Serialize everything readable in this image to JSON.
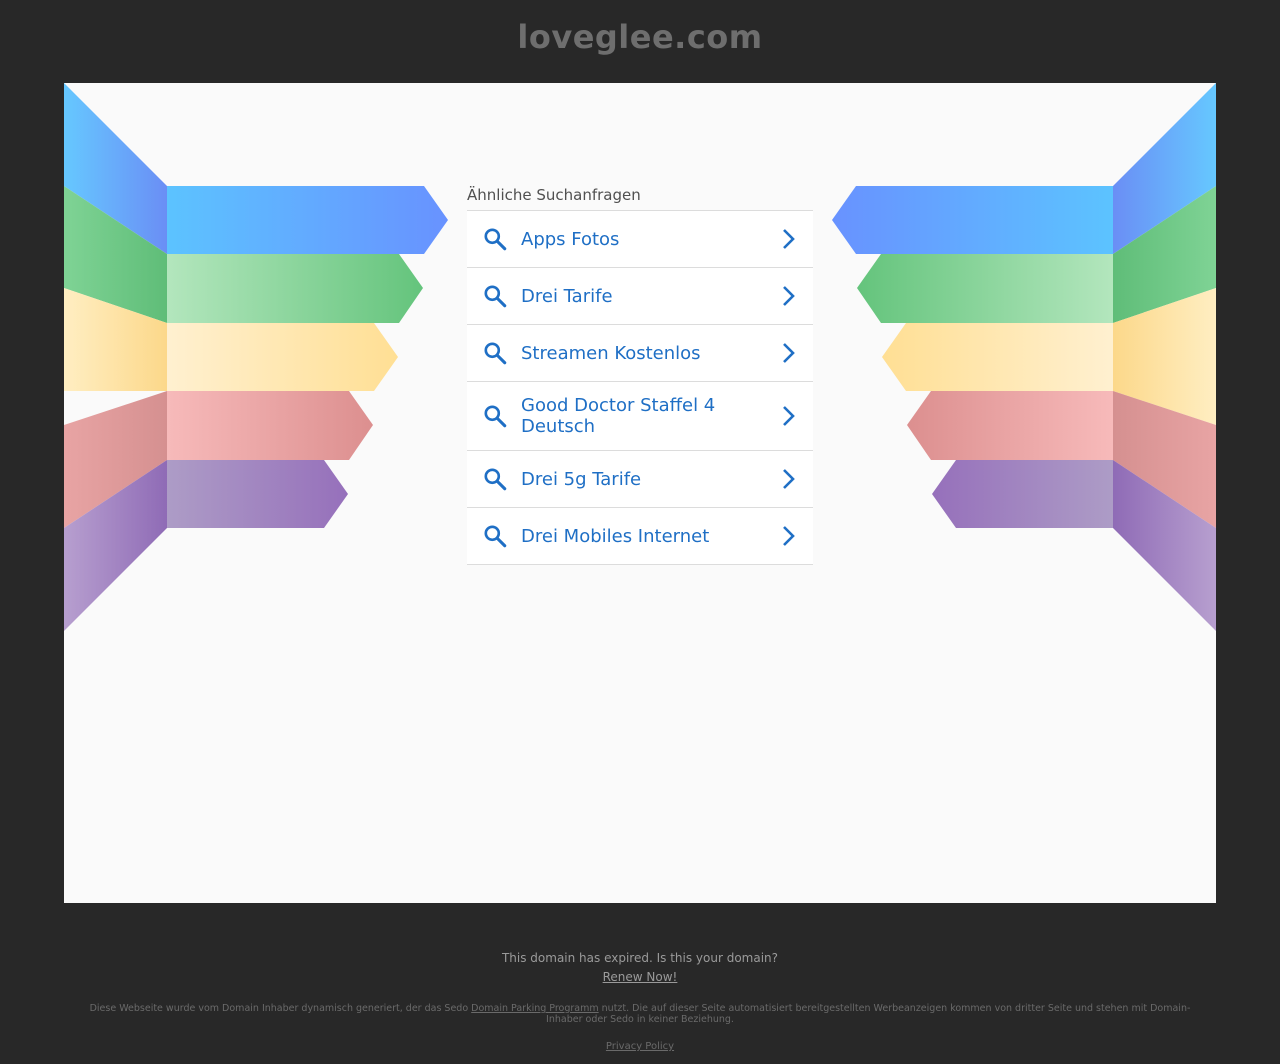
{
  "site": {
    "domain_title": "loveglee.com"
  },
  "related": {
    "heading": "Ähnliche Suchanfragen",
    "items": [
      {
        "label": "Apps Fotos"
      },
      {
        "label": "Drei Tarife"
      },
      {
        "label": "Streamen Kostenlos"
      },
      {
        "label": "Good Doctor Staffel 4 Deutsch"
      },
      {
        "label": "Drei 5g Tarife"
      },
      {
        "label": "Drei Mobiles Internet"
      }
    ]
  },
  "footer": {
    "expired_text": "This domain has expired. Is this your domain?",
    "renew_label": "Renew Now!",
    "disclaimer_before": "Diese Webseite wurde vom Domain Inhaber dynamisch generiert, der das Sedo ",
    "disclaimer_link": "Domain Parking Programm",
    "disclaimer_after": " nutzt. Die auf dieser Seite automatisiert bereitgestellten Werbeanzeigen kommen von dritter Seite und stehen mit Domain-Inhaber oder Sedo in keiner Beziehung.",
    "privacy_label": "Privacy Policy"
  },
  "colors": {
    "background": "#282828",
    "panel": "#fafafa",
    "link_blue": "#1f6fc5",
    "ribbon_blue": "#64b4ff",
    "ribbon_green": "#6cc783",
    "ribbon_yellow": "#ffe39a",
    "ribbon_red": "#e59a9a",
    "ribbon_purple": "#9b78be"
  },
  "icons": {
    "item_icon": "search-icon",
    "item_arrow": "chevron-right-icon"
  }
}
